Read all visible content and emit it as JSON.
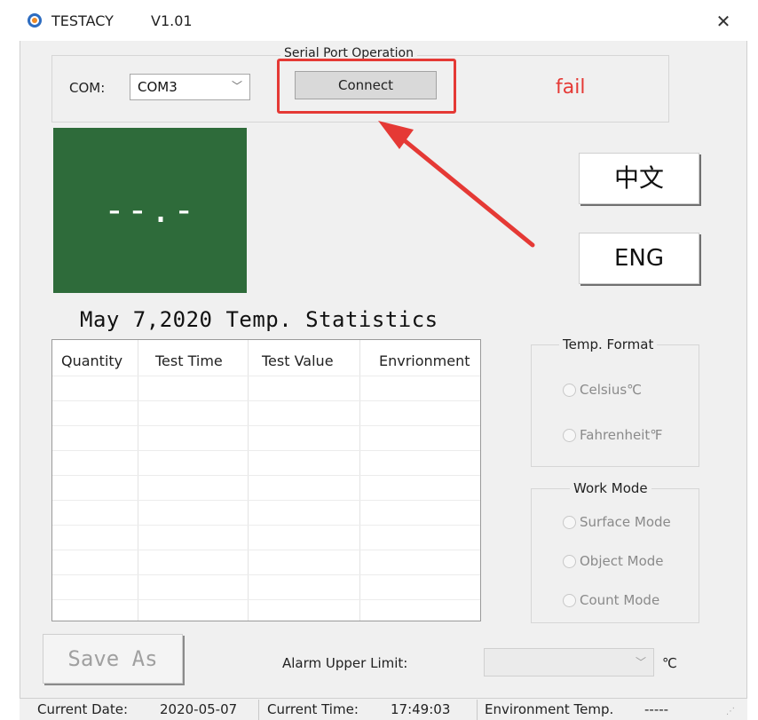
{
  "window": {
    "app_name": "TESTACY",
    "version": "V1.01",
    "close_glyph": "✕"
  },
  "serial": {
    "group_title": "Serial Port Operation",
    "com_label": "COM:",
    "com_value": "COM3",
    "connect_label": "Connect",
    "status_text": "fail",
    "highlight_color": "#e53935"
  },
  "display": {
    "reading": "--.-",
    "background": "#2e6b3a"
  },
  "language": {
    "chinese_label": "中文",
    "english_label": "ENG"
  },
  "stats": {
    "title": "May 7,2020 Temp. Statistics",
    "columns": [
      "Quantity",
      "Test Time",
      "Test Value",
      "Envrionment"
    ],
    "rows": []
  },
  "temp_format": {
    "title": "Temp. Format",
    "options": [
      "Celsius℃",
      "Fahrenheit℉"
    ]
  },
  "work_mode": {
    "title": "Work Mode",
    "options": [
      "Surface Mode",
      "Object Mode",
      "Count Mode"
    ]
  },
  "bottom": {
    "save_label": "Save As",
    "alarm_label": "Alarm Upper Limit:",
    "alarm_value": "",
    "unit": "℃"
  },
  "statusbar": {
    "date_label": "Current Date:",
    "date_value": "2020-05-07",
    "time_label": "Current Time:",
    "time_value": "17:49:03",
    "env_label": "Environment Temp.",
    "env_value": "-----"
  }
}
